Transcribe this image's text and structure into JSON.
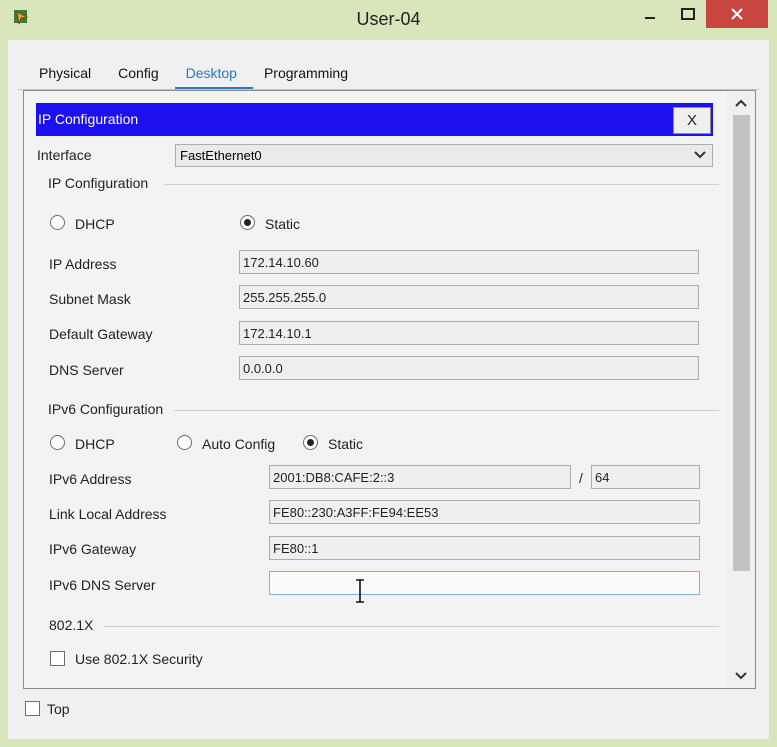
{
  "window": {
    "title": "User-04"
  },
  "tabs": [
    {
      "label": "Physical",
      "active": false
    },
    {
      "label": "Config",
      "active": false
    },
    {
      "label": "Desktop",
      "active": true
    },
    {
      "label": "Programming",
      "active": false
    }
  ],
  "ip_config": {
    "header": "IP Configuration",
    "close_label": "X",
    "interface_label": "Interface",
    "interface_value": "FastEthernet0",
    "section_label": "IP Configuration",
    "dhcp_label": "DHCP",
    "static_label": "Static",
    "mode": "Static",
    "fields": {
      "ip_address": {
        "label": "IP Address",
        "value": "172.14.10.60"
      },
      "subnet_mask": {
        "label": "Subnet Mask",
        "value": "255.255.255.0"
      },
      "default_gateway": {
        "label": "Default Gateway",
        "value": "172.14.10.1"
      },
      "dns_server": {
        "label": "DNS Server",
        "value": "0.0.0.0"
      }
    }
  },
  "ipv6_config": {
    "section_label": "IPv6 Configuration",
    "dhcp_label": "DHCP",
    "auto_label": "Auto Config",
    "static_label": "Static",
    "mode": "Static",
    "fields": {
      "ipv6_address": {
        "label": "IPv6 Address",
        "value": "2001:DB8:CAFE:2::3",
        "slash": "/",
        "prefix": "64"
      },
      "link_local": {
        "label": "Link Local Address",
        "value": "FE80::230:A3FF:FE94:EE53"
      },
      "ipv6_gateway": {
        "label": "IPv6 Gateway",
        "value": "FE80::1"
      },
      "ipv6_dns": {
        "label": "IPv6 DNS Server",
        "value": ""
      }
    }
  },
  "dot1x": {
    "section_label": "802.1X",
    "checkbox_label": "Use 802.1X Security",
    "checked": false
  },
  "footer": {
    "top_label": "Top",
    "checked": false
  },
  "colors": {
    "header_blue": "#1c10ef",
    "tab_active": "#2d76c0",
    "close_red": "#c9453f",
    "frame": "#d9e6bb"
  }
}
